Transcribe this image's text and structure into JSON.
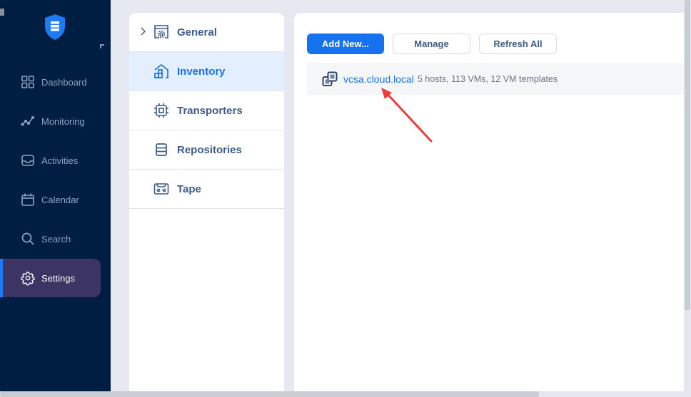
{
  "nav": {
    "logo": "veeam-shield-logo",
    "items": [
      {
        "id": "dashboard",
        "label": "Dashboard",
        "icon": "dashboard-grid-icon",
        "active": false
      },
      {
        "id": "monitoring",
        "label": "Monitoring",
        "icon": "monitoring-line-icon",
        "active": false
      },
      {
        "id": "activities",
        "label": "Activities",
        "icon": "inbox-tray-icon",
        "active": false
      },
      {
        "id": "calendar",
        "label": "Calendar",
        "icon": "calendar-icon",
        "active": false
      },
      {
        "id": "search",
        "label": "Search",
        "icon": "search-icon",
        "active": false
      },
      {
        "id": "settings",
        "label": "Settings",
        "icon": "gear-icon",
        "active": true
      }
    ]
  },
  "settings_menu": {
    "items": [
      {
        "id": "general",
        "label": "General",
        "icon": "settings-window-icon",
        "expandable": true,
        "active": false
      },
      {
        "id": "inventory",
        "label": "Inventory",
        "icon": "inventory-house-icon",
        "active": true
      },
      {
        "id": "transporters",
        "label": "Transporters",
        "icon": "chip-icon",
        "active": false
      },
      {
        "id": "repositories",
        "label": "Repositories",
        "icon": "storage-icon",
        "active": false
      },
      {
        "id": "tape",
        "label": "Tape",
        "icon": "tape-cassette-icon",
        "active": false
      }
    ]
  },
  "main": {
    "toolbar": {
      "add_new": "Add New...",
      "manage": "Manage",
      "refresh_all": "Refresh All"
    },
    "inventory_items": [
      {
        "name": "vcsa.cloud.local",
        "summary": "5 hosts, 113 VMs, 12 VM templates",
        "icon": "vcenter-icon"
      }
    ]
  },
  "annotation": {
    "type": "red-arrow",
    "color": "#ef3b3b",
    "points_to": "vcsa.cloud.local"
  },
  "colors": {
    "nav_bg": "#001d42",
    "accent": "#1672ee",
    "active_nav_bg": "#3b3464",
    "submenu_active_bg": "#e3efff"
  }
}
